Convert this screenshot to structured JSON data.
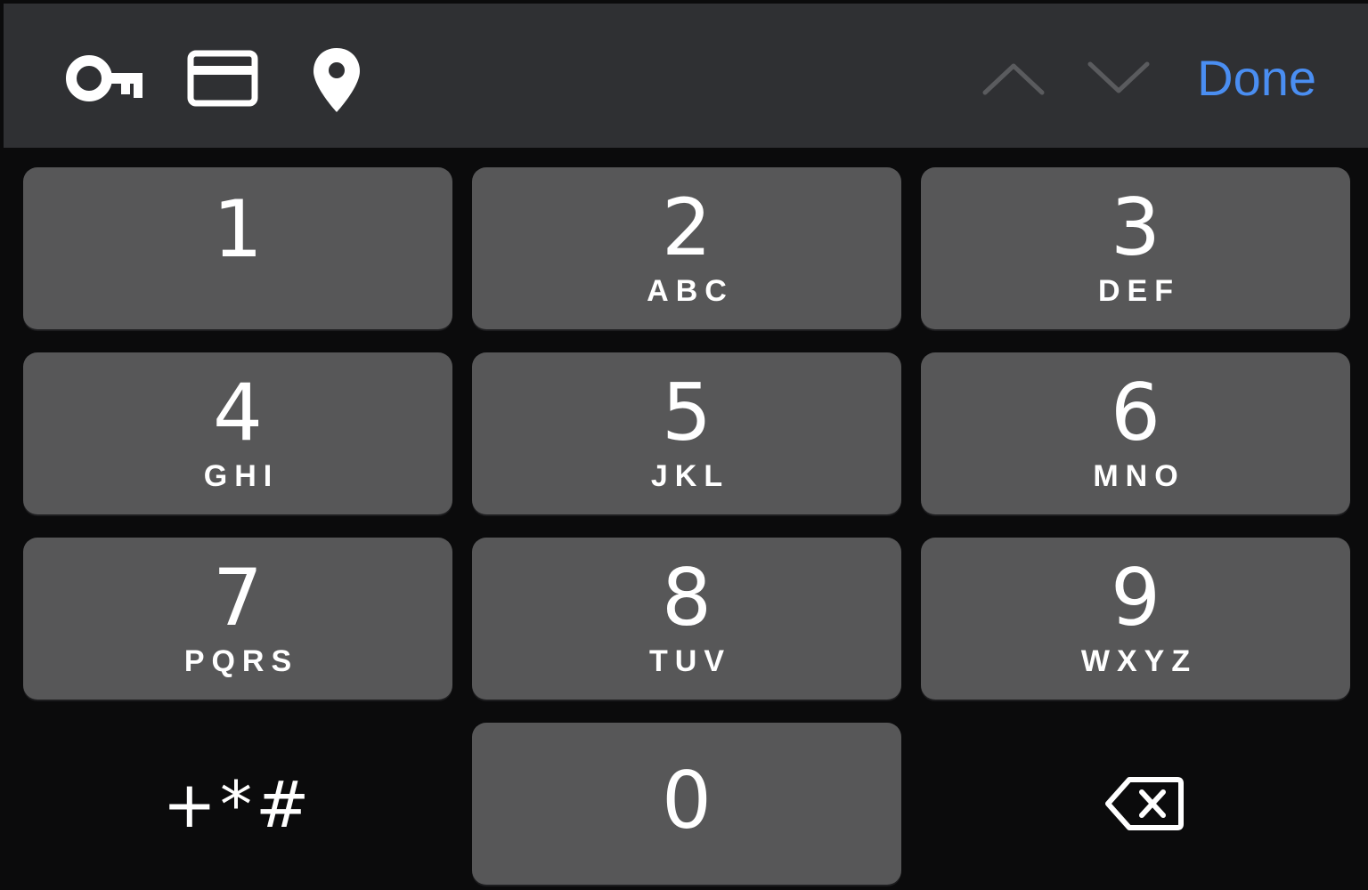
{
  "toolbar": {
    "done_label": "Done",
    "accent_color": "#4a8ef2",
    "icons": [
      "key-icon",
      "credit-card-icon",
      "location-pin-icon",
      "chevron-up-icon",
      "chevron-down-icon"
    ]
  },
  "keypad": {
    "keys": [
      {
        "digit": "1",
        "letters": ""
      },
      {
        "digit": "2",
        "letters": "ABC"
      },
      {
        "digit": "3",
        "letters": "DEF"
      },
      {
        "digit": "4",
        "letters": "GHI"
      },
      {
        "digit": "5",
        "letters": "JKL"
      },
      {
        "digit": "6",
        "letters": "MNO"
      },
      {
        "digit": "7",
        "letters": "PQRS"
      },
      {
        "digit": "8",
        "letters": "TUV"
      },
      {
        "digit": "9",
        "letters": "WXYZ"
      },
      {
        "digit": "0",
        "letters": ""
      }
    ],
    "symbols_label": "+*#",
    "delete_icon": "backspace-icon"
  }
}
